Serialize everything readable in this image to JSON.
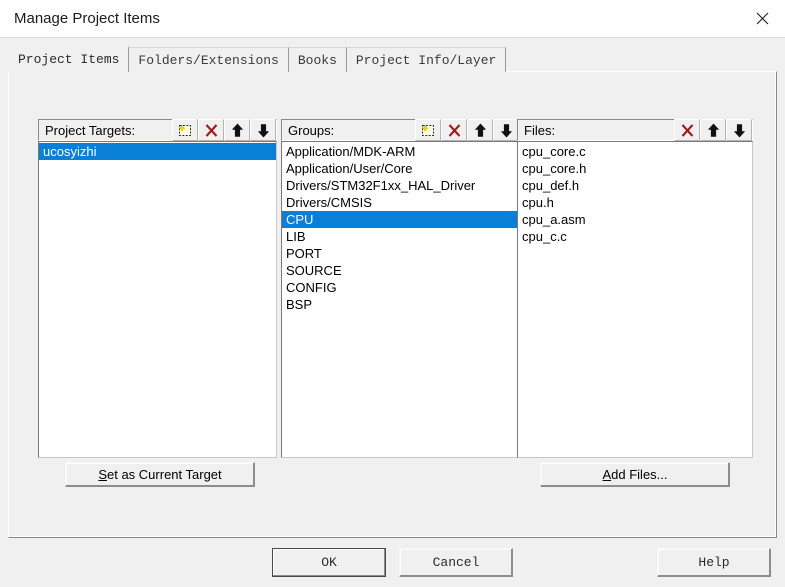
{
  "window": {
    "title": "Manage Project Items",
    "close_icon": "close-icon"
  },
  "tabs": [
    {
      "label": "Project Items",
      "active": true
    },
    {
      "label": "Folders/Extensions",
      "active": false
    },
    {
      "label": "Books",
      "active": false
    },
    {
      "label": "Project Info/Layer",
      "active": false
    }
  ],
  "panels": {
    "targets": {
      "title": "Project Targets:",
      "tools": [
        "new-item-icon",
        "delete-icon",
        "move-up-icon",
        "move-down-icon"
      ],
      "items": [
        {
          "label": "ucosyizhi",
          "selected": true
        }
      ]
    },
    "groups": {
      "title": "Groups:",
      "tools": [
        "new-item-icon",
        "delete-icon",
        "move-up-icon",
        "move-down-icon"
      ],
      "items": [
        {
          "label": "Application/MDK-ARM",
          "selected": false
        },
        {
          "label": "Application/User/Core",
          "selected": false
        },
        {
          "label": "Drivers/STM32F1xx_HAL_Driver",
          "selected": false
        },
        {
          "label": "Drivers/CMSIS",
          "selected": false
        },
        {
          "label": "CPU",
          "selected": true
        },
        {
          "label": "LIB",
          "selected": false
        },
        {
          "label": "PORT",
          "selected": false
        },
        {
          "label": "SOURCE",
          "selected": false
        },
        {
          "label": "CONFIG",
          "selected": false
        },
        {
          "label": "BSP",
          "selected": false
        }
      ]
    },
    "files": {
      "title": "Files:",
      "tools": [
        "delete-icon",
        "move-up-icon",
        "move-down-icon"
      ],
      "items": [
        {
          "label": "cpu_core.c",
          "selected": false
        },
        {
          "label": "cpu_core.h",
          "selected": false
        },
        {
          "label": "cpu_def.h",
          "selected": false
        },
        {
          "label": "cpu.h",
          "selected": false
        },
        {
          "label": "cpu_a.asm",
          "selected": false
        },
        {
          "label": "cpu_c.c",
          "selected": false
        }
      ]
    }
  },
  "actions": {
    "set_current_target": {
      "prefix": "",
      "accel": "S",
      "suffix": "et as Current Target"
    },
    "add_files": {
      "prefix": "",
      "accel": "A",
      "suffix": "dd Files..."
    }
  },
  "footer": {
    "ok": "OK",
    "cancel": "Cancel",
    "help": "Help"
  },
  "colors": {
    "selection_blue": "#0a7fd8",
    "dialog_face": "#f0f0f0",
    "delete_red": "#a01818",
    "star_yellow": "#ffd700"
  }
}
